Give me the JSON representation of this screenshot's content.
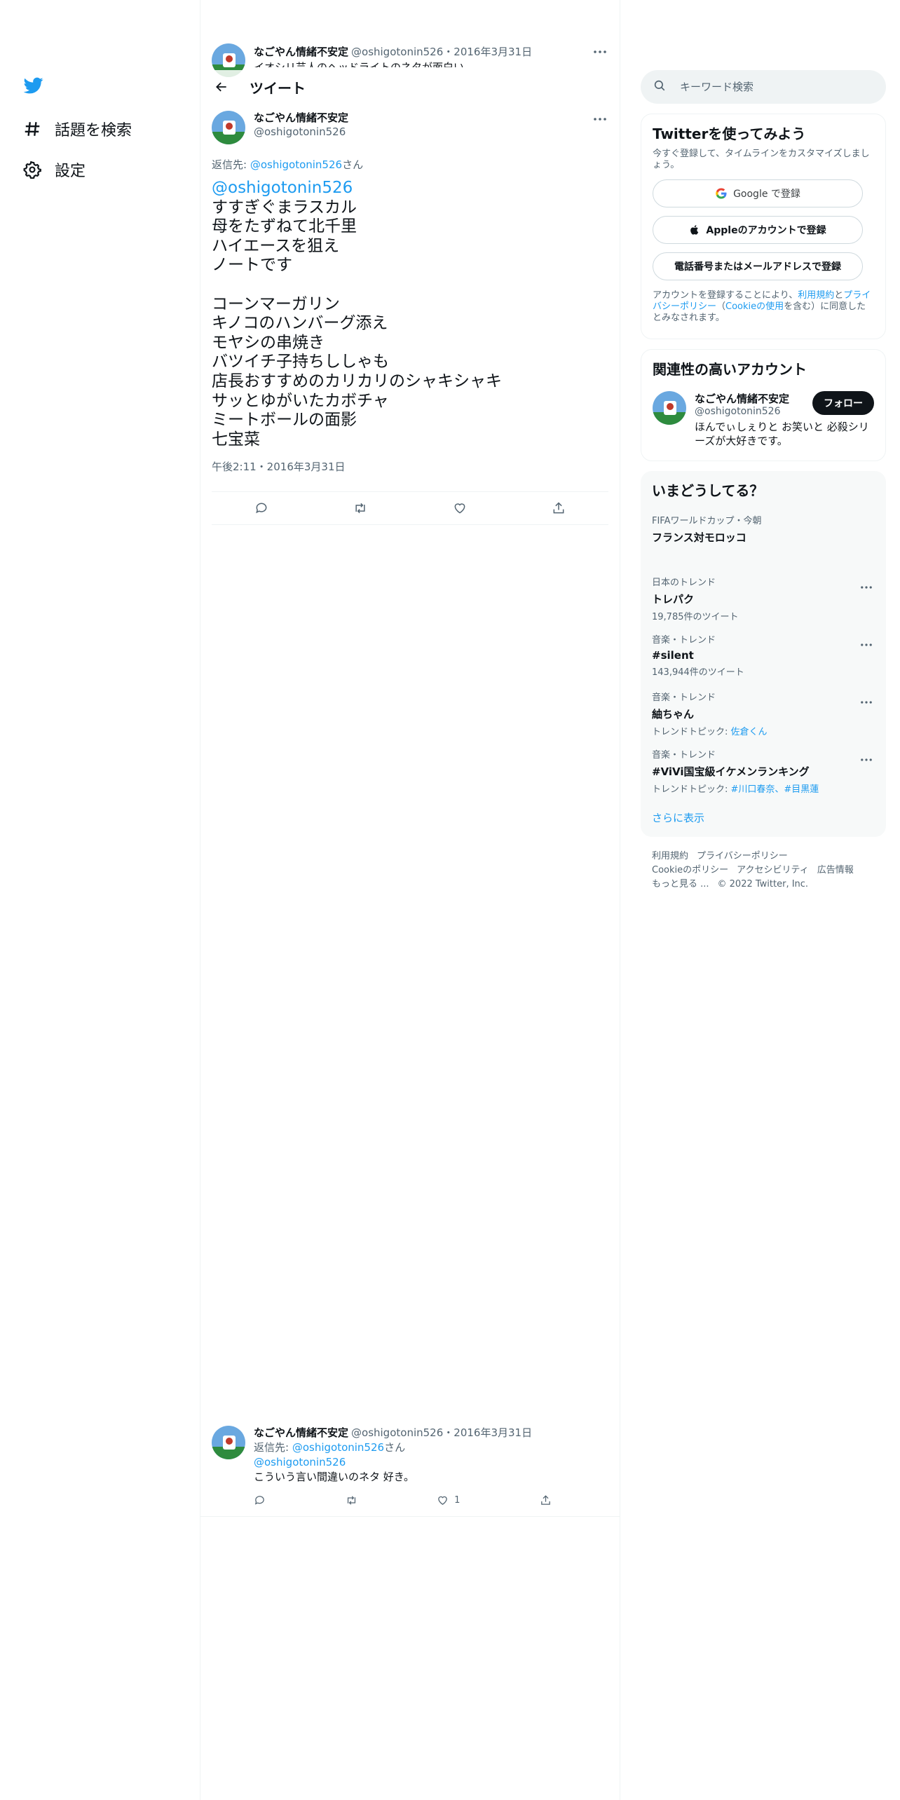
{
  "nav": {
    "items": [
      {
        "label": "話題を検索"
      },
      {
        "label": "設定"
      }
    ]
  },
  "prev_tweet": {
    "name": "なごやん情緒不安定",
    "handle": "@oshigotonin526",
    "date": "2016年3月31日",
    "text": "イオシリ芸人のヘッドライトのネタが面白い"
  },
  "header": {
    "title": "ツイート"
  },
  "main_tweet": {
    "name": "なごやん情緒不安定",
    "handle": "@oshigotonin526",
    "reply_prefix": "返信先: ",
    "reply_handle": "@oshigotonin526",
    "reply_suffix": "さん",
    "mention": "@oshigotonin526",
    "body": "すすぎぐまラスカル\n母をたずねて北千里\nハイエースを狙え\nノートです\n\nコーンマーガリン\nキノコのハンバーグ添え\nモヤシの串焼き\nバツイチ子持ちししゃも\n店長おすすめのカリカリのシャキシャキ\nサッとゆがいたカボチャ\nミートボールの面影\n七宝菜",
    "time": "午後2:11・2016年3月31日"
  },
  "reply_tweet": {
    "name": "なごやん情緒不安定",
    "handle": "@oshigotonin526",
    "date": "2016年3月31日",
    "reply_prefix": "返信先: ",
    "reply_handle": "@oshigotonin526",
    "reply_suffix": "さん",
    "mention": "@oshigotonin526",
    "text": "こういう言い間違いのネタ 好き。",
    "likes": "1"
  },
  "search": {
    "placeholder": "キーワード検索"
  },
  "signup": {
    "title": "Twitterを使ってみよう",
    "subtitle": "今すぐ登録して、タイムラインをカスタマイズしましょう。",
    "google": "Google で登録",
    "apple": "Appleのアカウントで登録",
    "phone": "電話番号またはメールアドレスで登録",
    "terms_1": "アカウントを登録することにより、",
    "terms_link1": "利用規約",
    "terms_2": "と",
    "terms_link2": "プライバシーポリシー",
    "terms_3": "（",
    "terms_link3": "Cookieの使用",
    "terms_4": "を含む）に同意したとみなされます。"
  },
  "related": {
    "title": "関連性の高いアカウント",
    "name": "なごやん情緒不安定",
    "handle": "@oshigotonin526",
    "follow": "フォロー",
    "bio": "ほんでぃしぇりと お笑いと 必殺シリーズが大好きです。"
  },
  "trends": {
    "title": "いまどうしてる？",
    "items": [
      {
        "category": "FIFAワールドカップ・今朝",
        "title": "フランス対モロッコ"
      },
      {
        "category": "日本のトレンド",
        "title": "トレパク",
        "count": "19,785件のツイート"
      },
      {
        "category": "音楽・トレンド",
        "title": "#silent",
        "count": "143,944件のツイート"
      },
      {
        "category": "音楽・トレンド",
        "title": "紬ちゃん",
        "topic_prefix": "トレンドトピック: ",
        "topic": "佐倉くん"
      },
      {
        "category": "音楽・トレンド",
        "title": "#ViVi国宝級イケメンランキング",
        "topic_prefix": "トレンドトピック: ",
        "topic": "#川口春奈、#目黒蓮"
      }
    ],
    "show_more": "さらに表示"
  },
  "footer": {
    "terms": "利用規約",
    "privacy": "プライバシーポリシー",
    "cookie": "Cookieのポリシー",
    "accessibility": "アクセシビリティ",
    "ads": "広告情報",
    "more": "もっと見る ...",
    "copyright": "© 2022 Twitter, Inc."
  },
  "colors": {
    "accent": "#1d9bf0",
    "text": "#0f1419",
    "muted": "#536471"
  }
}
